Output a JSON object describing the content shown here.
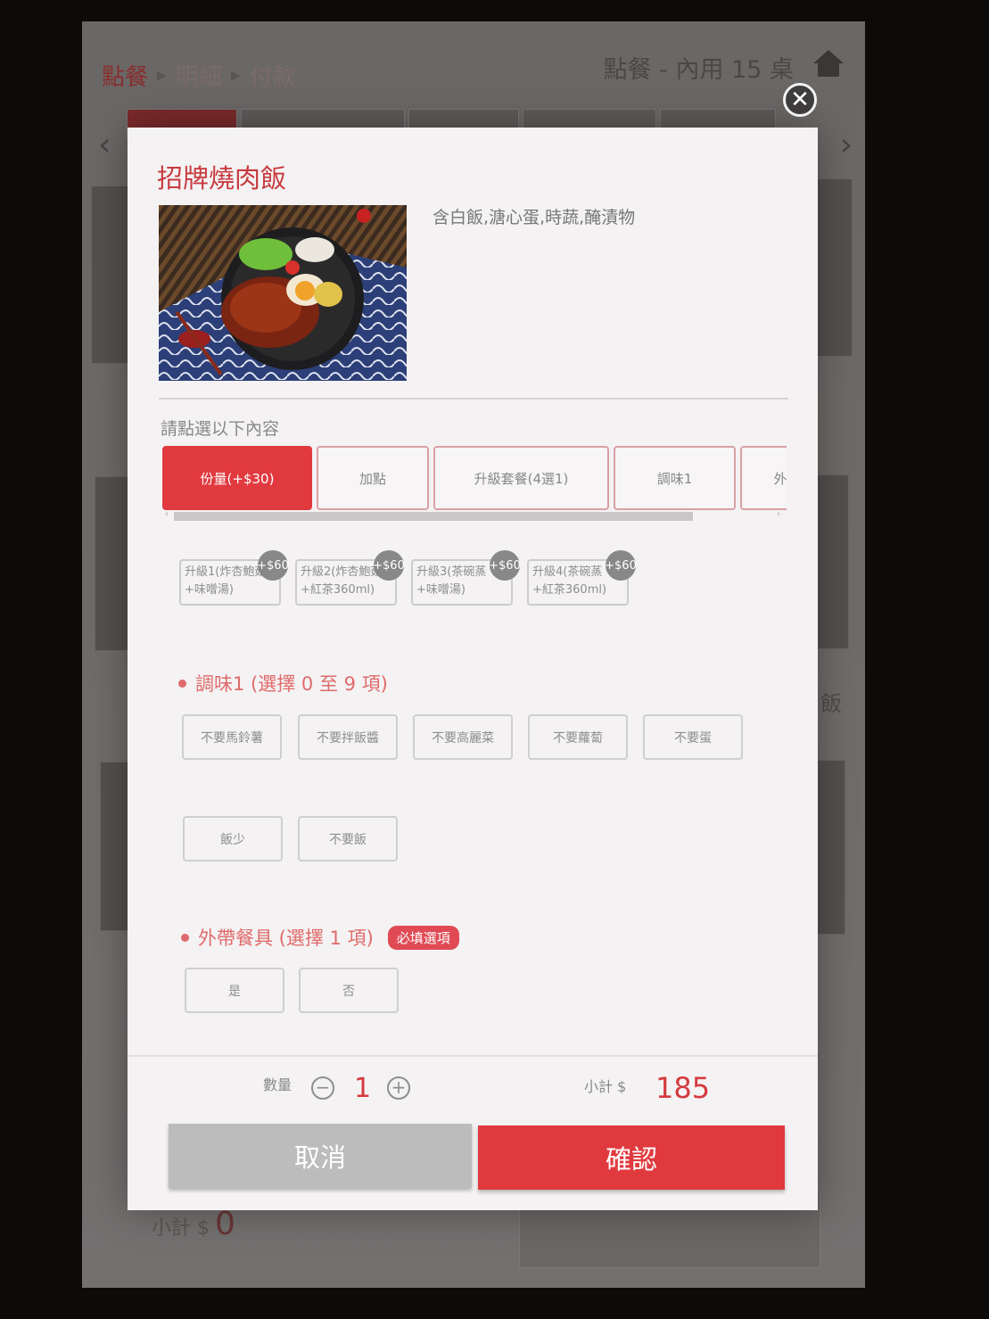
{
  "header": {
    "breadcrumbs": [
      "點餐",
      "明細",
      "付款"
    ],
    "table_info": "點餐 - 內用 15 桌"
  },
  "background": {
    "subtotal_label": "小計 $",
    "subtotal_value": "0",
    "side_text": "飯"
  },
  "modal": {
    "title": "招牌燒肉飯",
    "description": "含白飯,溏心蛋,時蔬,醃漬物",
    "prompt": "請點選以下內容",
    "tabs": [
      {
        "label": "份量(+$30)",
        "active": true
      },
      {
        "label": "加點",
        "active": false
      },
      {
        "label": "升級套餐(4選1)",
        "active": false
      },
      {
        "label": "調味1",
        "active": false
      },
      {
        "label": "外",
        "active": false
      }
    ],
    "upgrades": [
      {
        "label": "升級1(炸杏鮑菇+味噌湯)",
        "price": "+$60"
      },
      {
        "label": "升級2(炸杏鮑菇+紅茶360ml)",
        "price": "+$60"
      },
      {
        "label": "升級3(茶碗蒸+味噌湯)",
        "price": "+$60"
      },
      {
        "label": "升級4(茶碗蒸+紅茶360ml)",
        "price": "+$60"
      }
    ],
    "seasoning": {
      "title": "調味1 (選擇 0 至 9 項)",
      "options": [
        "不要馬鈴薯",
        "不要拌飯醬",
        "不要高麗菜",
        "不要蘿蔔",
        "不要蛋",
        "飯少",
        "不要飯"
      ]
    },
    "utensils": {
      "title": "外帶餐具 (選擇 1 項)",
      "required": "必填選項",
      "options": [
        "是",
        "否"
      ]
    },
    "quantity_label": "數量",
    "quantity": "1",
    "subtotal_label": "小計 $",
    "subtotal": "185",
    "cancel": "取消",
    "confirm": "確認"
  },
  "colors": {
    "accent": "#e03a3f",
    "title": "#c73a3e",
    "section": "#e06a6b"
  }
}
